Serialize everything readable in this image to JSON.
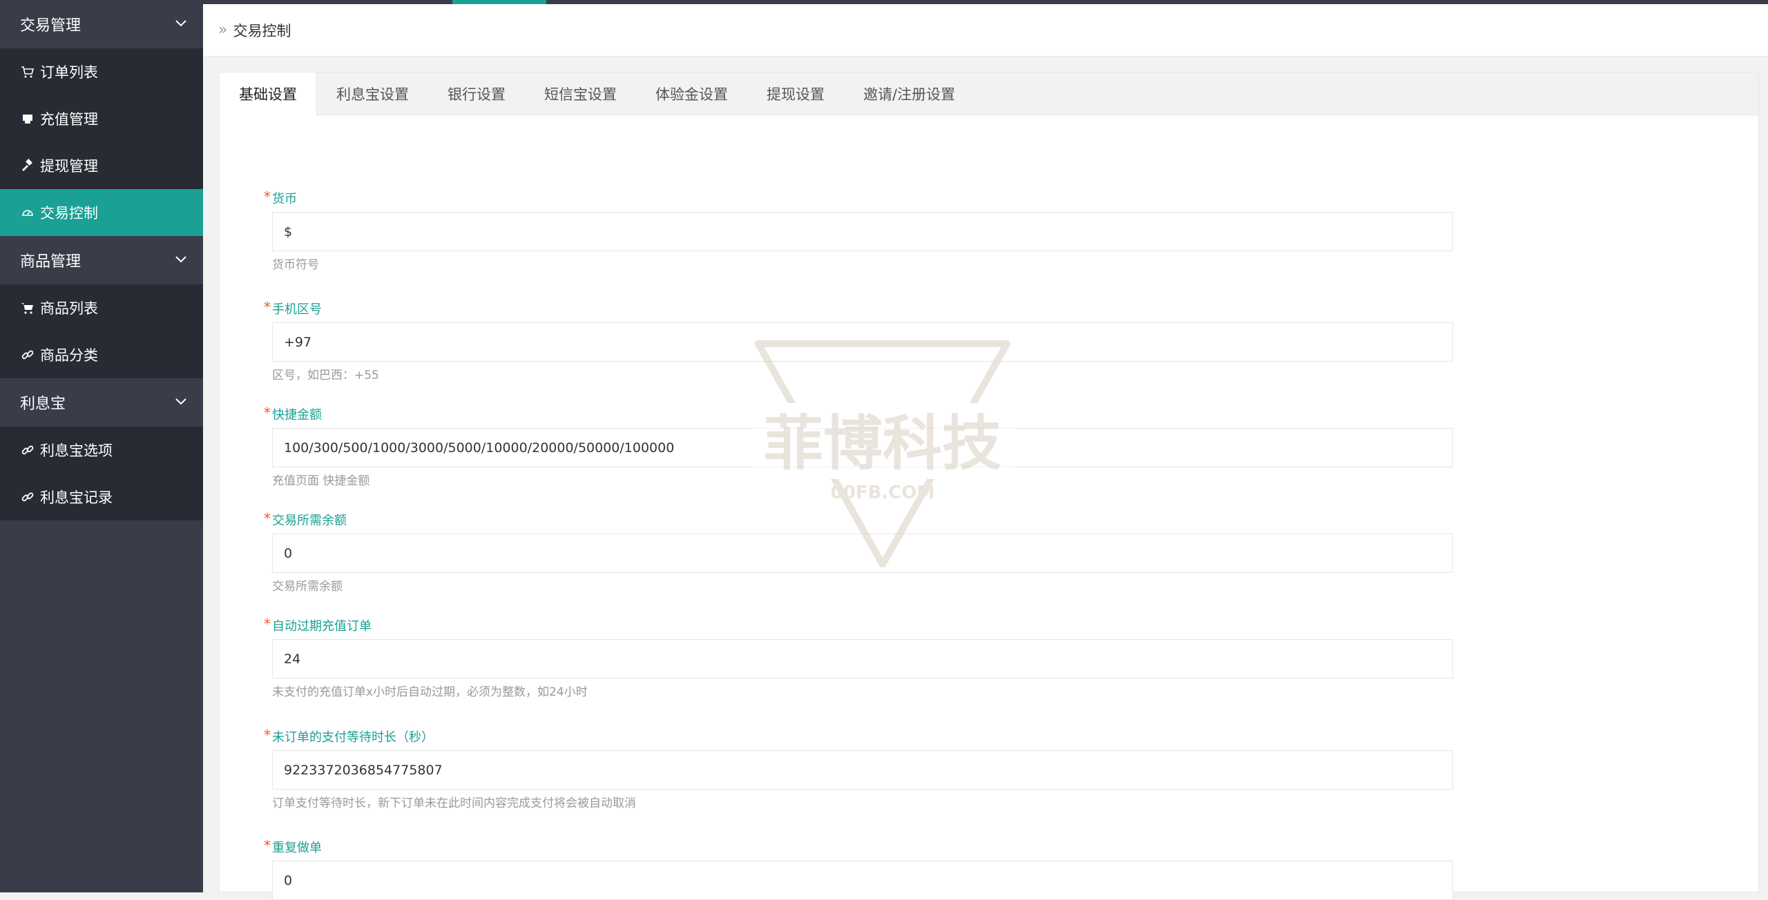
{
  "sidebar": {
    "groups": [
      {
        "label": "交易管理",
        "items": [
          "订单列表",
          "充值管理",
          "提现管理",
          "交易控制"
        ]
      },
      {
        "label": "商品管理",
        "items": [
          "商品列表",
          "商品分类"
        ]
      },
      {
        "label": "利息宝",
        "items": [
          "利息宝选项",
          "利息宝记录"
        ]
      }
    ],
    "active_item": "交易控制"
  },
  "breadcrumb": {
    "current": "交易控制"
  },
  "tabs": [
    "基础设置",
    "利息宝设置",
    "银行设置",
    "短信宝设置",
    "体验金设置",
    "提现设置",
    "邀请/注册设置"
  ],
  "active_tab": "基础设置",
  "form": {
    "fields": [
      {
        "label": "货币",
        "value": "$",
        "hint": "货币符号"
      },
      {
        "label": "手机区号",
        "value": "+97",
        "hint": "区号，如巴西：+55"
      },
      {
        "label": "快捷金额",
        "value": "100/300/500/1000/3000/5000/10000/20000/50000/100000",
        "hint": "充值页面 快捷金额"
      },
      {
        "label": "交易所需余额",
        "value": "0",
        "hint": "交易所需余额"
      },
      {
        "label": "自动过期充值订单",
        "value": "24",
        "hint": "未支付的充值订单x小时后自动过期，必须为整数，如24小时"
      },
      {
        "label": "未订单的支付等待时长（秒）",
        "value": "9223372036854775807",
        "hint": "订单支付等待时长，新下订单未在此时间内容完成支付将会被自动取消"
      },
      {
        "label": "重复做单",
        "value": "0",
        "hint": ""
      }
    ]
  },
  "watermark": {
    "text": "菲博科技",
    "subtext": "00FB.COM"
  },
  "colors": {
    "accent": "#1aa094",
    "sidebar_bg": "#393d49",
    "sidebar_item_bg": "#282b33",
    "required": "#ff5722"
  }
}
